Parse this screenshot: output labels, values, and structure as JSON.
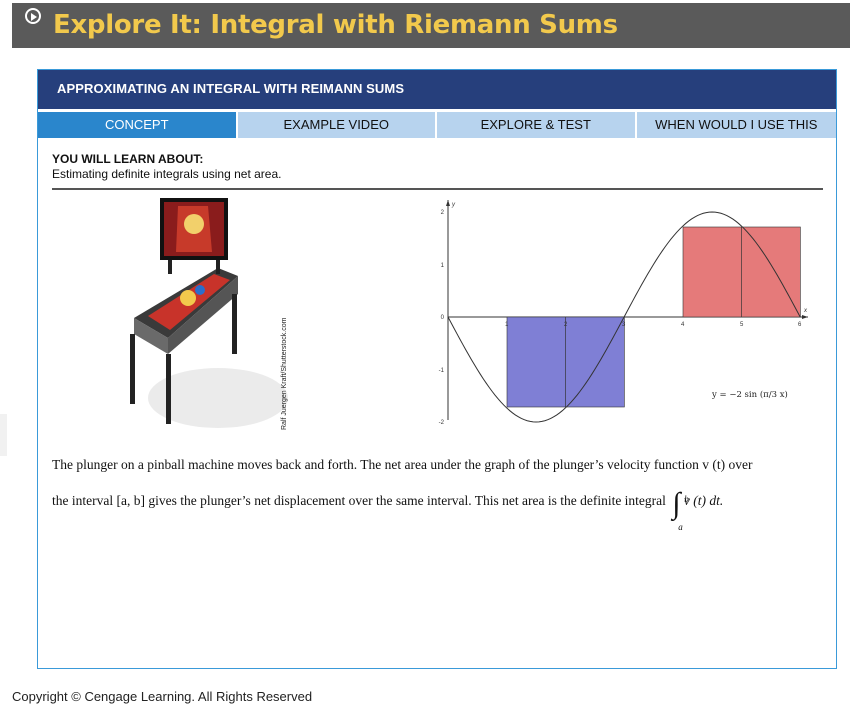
{
  "window": {
    "title": "Explore It: Integral with Riemann Sums"
  },
  "panel": {
    "header": "APPROXIMATING AN INTEGRAL WITH REIMANN SUMS",
    "tabs": [
      {
        "label": "CONCEPT",
        "active": true
      },
      {
        "label": "EXAMPLE VIDEO",
        "active": false
      },
      {
        "label": "EXPLORE & TEST",
        "active": false
      },
      {
        "label": "WHEN WOULD I USE THIS",
        "active": false
      }
    ],
    "learn_heading": "YOU WILL LEARN ABOUT:",
    "learn_text": "Estimating definite integrals using net area.",
    "image_credit": "Ralf Juergen Kraft/Shutterstock.com",
    "paragraph": {
      "line1": "The plunger on a pinball machine moves back and forth. The net area under the graph of the plunger’s velocity function v (t) over",
      "line2": "the interval [a, b] gives the plunger’s net displacement over the same interval. This net area is the definite integral",
      "integral_expr": "v (t) dt.",
      "upper_limit": "b",
      "lower_limit": "a"
    }
  },
  "graph": {
    "y_axis_label": "y",
    "x_axis_label": "x",
    "x_ticks": [
      "1",
      "2",
      "3",
      "4",
      "5",
      "6"
    ],
    "y_ticks": [
      "2",
      "1",
      "0",
      "-1",
      "-2"
    ],
    "equation": "y = −2 sin (π/3 x)",
    "negative_color": "#7f7fd5",
    "positive_color": "#e57a7a"
  },
  "footer": {
    "copyright": "Copyright © Cengage Learning. All Rights Reserved"
  }
}
